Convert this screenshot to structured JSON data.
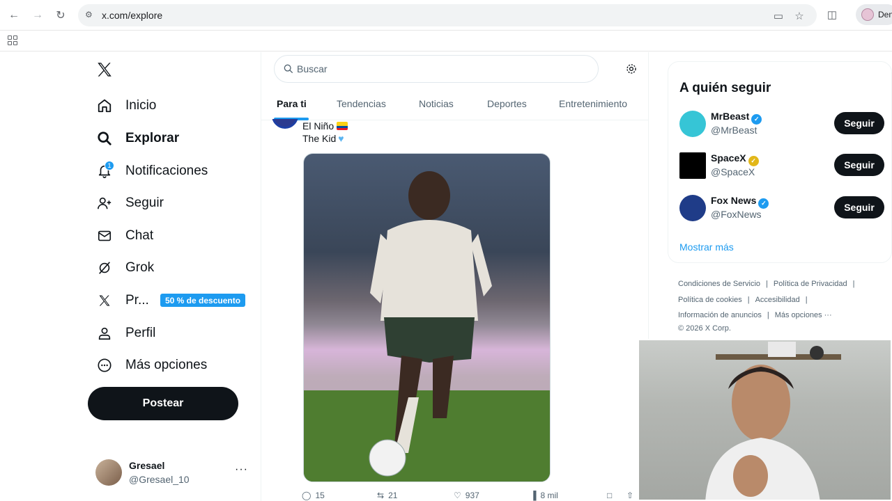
{
  "browser": {
    "url": "x.com/explore",
    "profile_label": "Den"
  },
  "nav": {
    "items": [
      {
        "label": "Inicio",
        "icon": "home-icon"
      },
      {
        "label": "Explorar",
        "icon": "search-icon"
      },
      {
        "label": "Notificaciones",
        "icon": "bell-icon",
        "badge": "1"
      },
      {
        "label": "Seguir",
        "icon": "add-person-icon"
      },
      {
        "label": "Chat",
        "icon": "mail-icon"
      },
      {
        "label": "Grok",
        "icon": "grok-icon"
      },
      {
        "label": "Pr...",
        "icon": "x-premium-icon",
        "promo": "50 % de descuento"
      },
      {
        "label": "Perfil",
        "icon": "person-icon"
      },
      {
        "label": "Más opciones",
        "icon": "more-circle-icon"
      }
    ],
    "post_label": "Postear",
    "account": {
      "name": "Gresael",
      "handle": "@Gresael_10"
    }
  },
  "search": {
    "placeholder": "Buscar"
  },
  "tabs": [
    "Para ti",
    "Tendencias",
    "Noticias",
    "Deportes",
    "Entretenimiento"
  ],
  "tweet": {
    "line1": "El Niño",
    "line2": "The Kid",
    "stats": {
      "replies": "15",
      "reposts": "21",
      "likes": "937",
      "views": "8 mil"
    }
  },
  "who_to_follow": {
    "title": "A quién seguir",
    "accounts": [
      {
        "name": "MrBeast",
        "handle": "@MrBeast",
        "verified": "blue",
        "button": "Seguir"
      },
      {
        "name": "SpaceX",
        "handle": "@SpaceX",
        "verified": "gold",
        "button": "Seguir"
      },
      {
        "name": "Fox News",
        "handle": "@FoxNews",
        "verified": "blue",
        "button": "Seguir"
      }
    ],
    "show_more": "Mostrar más"
  },
  "footer": {
    "links": [
      "Condiciones de Servicio",
      "Política de Privacidad",
      "Política de cookies",
      "Accesibilidad",
      "Información de anuncios",
      "Más opciones ···"
    ],
    "copyright": "© 2026 X Corp."
  },
  "colors": {
    "accent": "#1d9bf0",
    "text": "#0f1419",
    "muted": "#536471"
  }
}
